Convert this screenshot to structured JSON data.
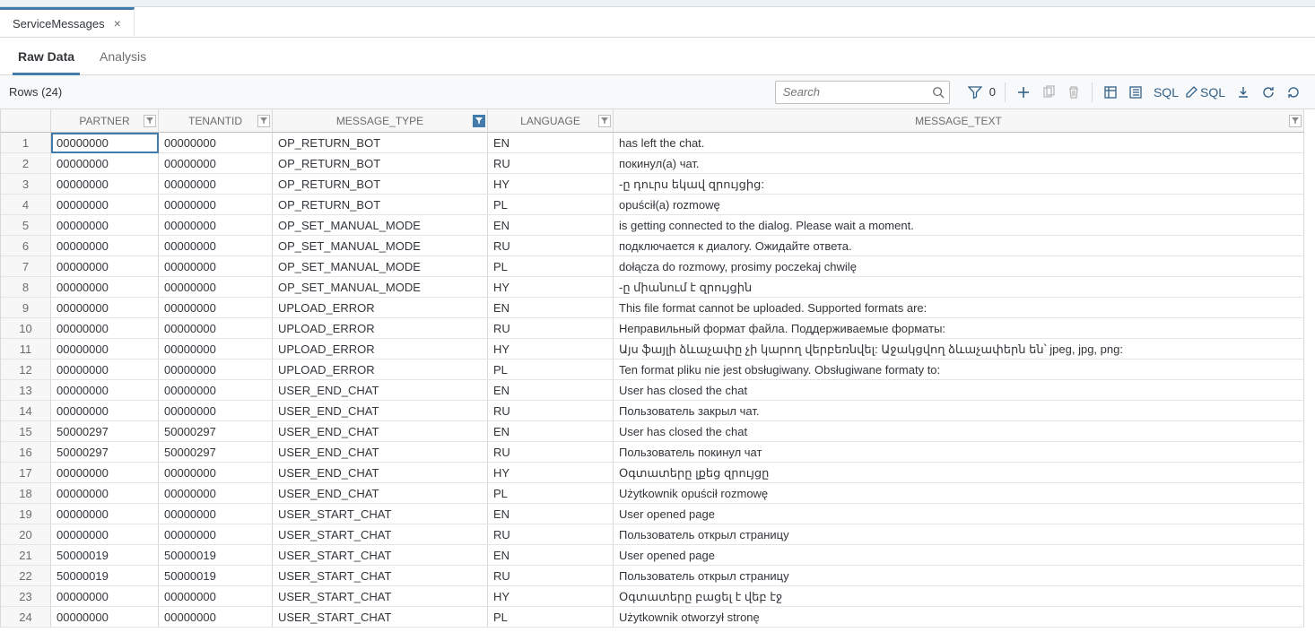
{
  "file_tabs": [
    {
      "label": "ServiceMessages",
      "active": true
    }
  ],
  "sub_tabs": {
    "raw_data": "Raw Data",
    "analysis": "Analysis"
  },
  "toolbar": {
    "rows_label": "Rows (24)",
    "search_placeholder": "Search",
    "filter_count": "0",
    "sql_label": "SQL",
    "sql_edit_label": "SQL"
  },
  "columns": [
    {
      "key": "rownum",
      "label": ""
    },
    {
      "key": "partner",
      "label": "PARTNER",
      "filter": "off"
    },
    {
      "key": "tenantid",
      "label": "TENANTID",
      "filter": "off"
    },
    {
      "key": "message_type",
      "label": "MESSAGE_TYPE",
      "filter": "on"
    },
    {
      "key": "language",
      "label": "LANGUAGE",
      "filter": "off"
    },
    {
      "key": "message_text",
      "label": "MESSAGE_TEXT",
      "filter": "off"
    }
  ],
  "rows": [
    {
      "n": 1,
      "partner": "00000000",
      "tenantid": "00000000",
      "message_type": "OP_RETURN_BOT",
      "language": "EN",
      "message_text": "has left the chat."
    },
    {
      "n": 2,
      "partner": "00000000",
      "tenantid": "00000000",
      "message_type": "OP_RETURN_BOT",
      "language": "RU",
      "message_text": "покинул(а) чат."
    },
    {
      "n": 3,
      "partner": "00000000",
      "tenantid": "00000000",
      "message_type": "OP_RETURN_BOT",
      "language": "HY",
      "message_text": "-ը դուրս եկավ զրույցից:"
    },
    {
      "n": 4,
      "partner": "00000000",
      "tenantid": "00000000",
      "message_type": "OP_RETURN_BOT",
      "language": "PL",
      "message_text": "opuścił(a) rozmowę"
    },
    {
      "n": 5,
      "partner": "00000000",
      "tenantid": "00000000",
      "message_type": "OP_SET_MANUAL_MODE",
      "language": "EN",
      "message_text": "is getting connected to the dialog. Please wait a moment."
    },
    {
      "n": 6,
      "partner": "00000000",
      "tenantid": "00000000",
      "message_type": "OP_SET_MANUAL_MODE",
      "language": "RU",
      "message_text": "подключается к диалогу. Ожидайте ответа."
    },
    {
      "n": 7,
      "partner": "00000000",
      "tenantid": "00000000",
      "message_type": "OP_SET_MANUAL_MODE",
      "language": "PL",
      "message_text": "dołącza do rozmowy, prosimy poczekaj chwilę"
    },
    {
      "n": 8,
      "partner": "00000000",
      "tenantid": "00000000",
      "message_type": "OP_SET_MANUAL_MODE",
      "language": "HY",
      "message_text": "-ը միանում է զրույցին"
    },
    {
      "n": 9,
      "partner": "00000000",
      "tenantid": "00000000",
      "message_type": "UPLOAD_ERROR",
      "language": "EN",
      "message_text": "This file format cannot be uploaded. Supported formats are:"
    },
    {
      "n": 10,
      "partner": "00000000",
      "tenantid": "00000000",
      "message_type": "UPLOAD_ERROR",
      "language": "RU",
      "message_text": "Неправильный формат файла. Поддерживаемые форматы:"
    },
    {
      "n": 11,
      "partner": "00000000",
      "tenantid": "00000000",
      "message_type": "UPLOAD_ERROR",
      "language": "HY",
      "message_text": "Այս ֆայլի ձևաչափը չի կարող վերբեռնվել: Աջակցվող ձևաչափերն են՝ jpeg, jpg, png:"
    },
    {
      "n": 12,
      "partner": "00000000",
      "tenantid": "00000000",
      "message_type": "UPLOAD_ERROR",
      "language": "PL",
      "message_text": "Ten format pliku nie jest obsługiwany. Obsługiwane formaty to:"
    },
    {
      "n": 13,
      "partner": "00000000",
      "tenantid": "00000000",
      "message_type": "USER_END_CHAT",
      "language": "EN",
      "message_text": "User has closed the chat"
    },
    {
      "n": 14,
      "partner": "00000000",
      "tenantid": "00000000",
      "message_type": "USER_END_CHAT",
      "language": "RU",
      "message_text": "Пользователь закрыл чат."
    },
    {
      "n": 15,
      "partner": "50000297",
      "tenantid": "50000297",
      "message_type": "USER_END_CHAT",
      "language": "EN",
      "message_text": "User has closed the chat"
    },
    {
      "n": 16,
      "partner": "50000297",
      "tenantid": "50000297",
      "message_type": "USER_END_CHAT",
      "language": "RU",
      "message_text": "Пользователь покинул чат"
    },
    {
      "n": 17,
      "partner": "00000000",
      "tenantid": "00000000",
      "message_type": "USER_END_CHAT",
      "language": "HY",
      "message_text": "Օգտատերը լքեց զրույցը"
    },
    {
      "n": 18,
      "partner": "00000000",
      "tenantid": "00000000",
      "message_type": "USER_END_CHAT",
      "language": "PL",
      "message_text": "Użytkownik opuścił rozmowę"
    },
    {
      "n": 19,
      "partner": "00000000",
      "tenantid": "00000000",
      "message_type": "USER_START_CHAT",
      "language": "EN",
      "message_text": "User opened page"
    },
    {
      "n": 20,
      "partner": "00000000",
      "tenantid": "00000000",
      "message_type": "USER_START_CHAT",
      "language": "RU",
      "message_text": "Пользователь открыл страницу"
    },
    {
      "n": 21,
      "partner": "50000019",
      "tenantid": "50000019",
      "message_type": "USER_START_CHAT",
      "language": "EN",
      "message_text": "User opened page"
    },
    {
      "n": 22,
      "partner": "50000019",
      "tenantid": "50000019",
      "message_type": "USER_START_CHAT",
      "language": "RU",
      "message_text": "Пользователь открыл страницу"
    },
    {
      "n": 23,
      "partner": "00000000",
      "tenantid": "00000000",
      "message_type": "USER_START_CHAT",
      "language": "HY",
      "message_text": "Օգտատերը բացել է վեբ էջ"
    },
    {
      "n": 24,
      "partner": "00000000",
      "tenantid": "00000000",
      "message_type": "USER_START_CHAT",
      "language": "PL",
      "message_text": "Użytkownik otworzył stronę"
    }
  ]
}
